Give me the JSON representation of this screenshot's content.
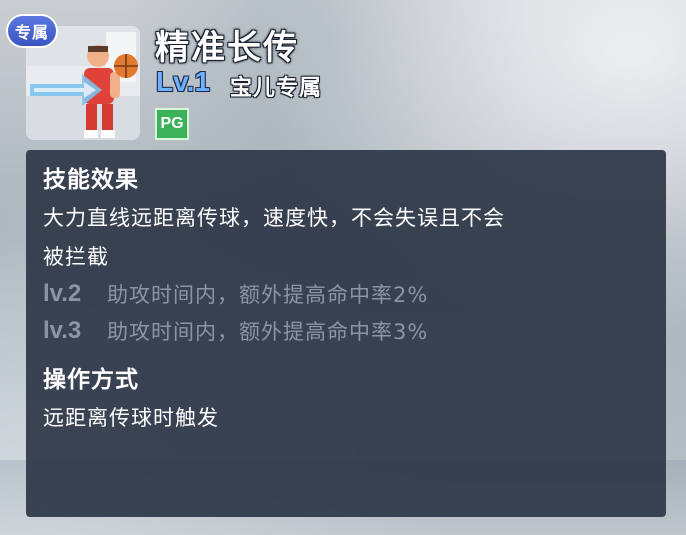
{
  "skill": {
    "name": "精准长传",
    "level": "Lv.1",
    "owner": "宝儿专属",
    "position": "PG",
    "exclusive_badge": "专属"
  },
  "effect": {
    "heading": "技能效果",
    "description_line1": "大力直线远距离传球，速度快，不会失误且不会",
    "description_line2": "被拦截",
    "upgrades": [
      {
        "level": "lv.2",
        "text": "助攻时间内，额外提高命中率2%"
      },
      {
        "level": "lv.3",
        "text": "助攻时间内，额外提高命中率3%"
      }
    ]
  },
  "operation": {
    "heading": "操作方式",
    "text": "远距离传球时触发"
  },
  "colors": {
    "level_blue": "#6fb0ff",
    "position_green": "#3bb25a",
    "badge_blue": "#3a54c0",
    "panel_bg": "#2c3646",
    "upgrade_gray": "#8b95a3"
  }
}
